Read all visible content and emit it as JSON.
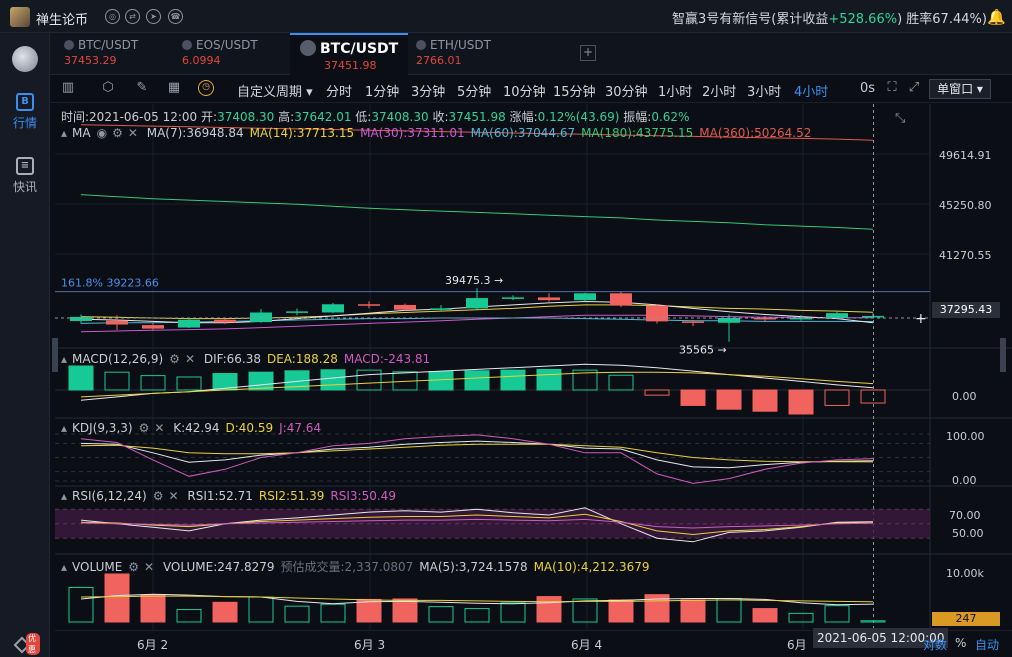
{
  "app": {
    "name": "禅生论币"
  },
  "signal": {
    "prefix": "智赢3号有新信号(累计收益",
    "gain": "+528.66%",
    "suffix": ")  胜率67.44%)"
  },
  "sidebar": {
    "items": [
      {
        "label": "行情",
        "icon": "B"
      },
      {
        "label": "快讯",
        "icon": "≡"
      }
    ],
    "promo": "优惠"
  },
  "tabs": [
    {
      "name": "BTC/USDT",
      "price": "37453.29"
    },
    {
      "name": "EOS/USDT",
      "price": "6.0994"
    },
    {
      "name": "BTC/USDT",
      "price": "37451.98"
    },
    {
      "name": "ETH/USDT",
      "price": "2766.01"
    }
  ],
  "toolbar": {
    "custom": "自定义周期",
    "intervals": [
      "分时",
      "1分钟",
      "3分钟",
      "5分钟",
      "10分钟",
      "15分钟",
      "30分钟",
      "1小时",
      "2小时",
      "3小时",
      "4小时"
    ],
    "active_interval": "4小时",
    "zero": "0s",
    "window": "单窗口"
  },
  "ohlc": {
    "time": "时间:2021-06-05 12:00",
    "open_label": "开:",
    "open": "37408.30",
    "high_label": "高:",
    "high": "37642.01",
    "low_label": "低:",
    "low": "37408.30",
    "close_label": "收:",
    "close": "37451.98",
    "chg_label": "涨幅:",
    "chg": "0.12%(43.69)",
    "amp_label": "振幅:",
    "amp": "0.62%"
  },
  "ma": {
    "name": "MA",
    "v7": "MA(7):36948.84",
    "v14": "MA(14):37713.15",
    "v30": "MA(30):37311.01",
    "v60": "MA(60):37044.67",
    "v180": "MA(180):43775.15",
    "v360": "MA(360):50264.52"
  },
  "price_axis": [
    "49614.91",
    "45250.80",
    "41270.55"
  ],
  "current_price": "37295.43",
  "fib": "161.8% 39223.66",
  "annotations": {
    "high": "39475.3 →",
    "low": "35565 →"
  },
  "macd": {
    "name": "MACD(12,26,9)",
    "dif": "DIF:66.38",
    "dea": "DEA:188.28",
    "macd": "MACD:-243.81",
    "axis": "0.00"
  },
  "kdj": {
    "name": "KDJ(9,3,3)",
    "k": "K:42.94",
    "d": "D:40.59",
    "j": "J:47.64",
    "axis_top": "100.00",
    "axis_bot": "0.00"
  },
  "rsi": {
    "name": "RSI(6,12,24)",
    "r1": "RSI1:52.71",
    "r2": "RSI2:51.39",
    "r3": "RSI3:50.49",
    "axis_top": "70.00",
    "axis_mid": "50.00"
  },
  "volume": {
    "name": "VOLUME",
    "v": "VOLUME:247.8279",
    "est": "预估成交量:2,337.0807",
    "ma5": "MA(5):3,724.1578",
    "ma10": "MA(10):4,212.3679",
    "axis": "10.00k",
    "current": "247"
  },
  "timeaxis": {
    "labels": [
      "6月 2",
      "6月 3",
      "6月 4",
      "6月"
    ],
    "cursor": "2021-06-05 12:00:00",
    "log": "对数",
    "pct": "%",
    "auto": "自动"
  },
  "colors": {
    "up": "#16c995",
    "down": "#f0635e",
    "accent": "#3b8ff0"
  },
  "chart_data": {
    "type": "candlestick",
    "candles": [
      {
        "o": 37080,
        "c": 37380,
        "h": 37560,
        "l": 36880
      },
      {
        "o": 37100,
        "c": 36820,
        "h": 37500,
        "l": 36420
      },
      {
        "o": 36780,
        "c": 36520,
        "h": 36960,
        "l": 36400
      },
      {
        "o": 36600,
        "c": 37170,
        "h": 37300,
        "l": 36560
      },
      {
        "o": 37170,
        "c": 36980,
        "h": 37250,
        "l": 36850
      },
      {
        "o": 37000,
        "c": 37700,
        "h": 37950,
        "l": 36950
      },
      {
        "o": 37700,
        "c": 37780,
        "h": 37990,
        "l": 37500
      },
      {
        "o": 37700,
        "c": 38300,
        "h": 38400,
        "l": 37650
      },
      {
        "o": 38300,
        "c": 38280,
        "h": 38520,
        "l": 38000
      },
      {
        "o": 38250,
        "c": 37900,
        "h": 38350,
        "l": 37800
      },
      {
        "o": 37900,
        "c": 38000,
        "h": 38250,
        "l": 37750
      },
      {
        "o": 38000,
        "c": 38750,
        "h": 39475.3,
        "l": 37900
      },
      {
        "o": 38750,
        "c": 38800,
        "h": 38950,
        "l": 38600
      },
      {
        "o": 38800,
        "c": 38600,
        "h": 39100,
        "l": 38480
      },
      {
        "o": 38600,
        "c": 39100,
        "h": 39150,
        "l": 38500
      },
      {
        "o": 39100,
        "c": 38200,
        "h": 39200,
        "l": 38100
      },
      {
        "o": 38200,
        "c": 37050,
        "h": 38300,
        "l": 36900
      },
      {
        "o": 37050,
        "c": 36950,
        "h": 37150,
        "l": 36700
      },
      {
        "o": 36950,
        "c": 37300,
        "h": 37550,
        "l": 35565
      },
      {
        "o": 37300,
        "c": 37250,
        "h": 37450,
        "l": 37000
      },
      {
        "o": 37250,
        "c": 37300,
        "h": 37520,
        "l": 37100
      },
      {
        "o": 37300,
        "c": 37650,
        "h": 37800,
        "l": 37250
      },
      {
        "o": 37400,
        "c": 37450,
        "h": 37650,
        "l": 37400
      }
    ],
    "ma7": [
      37200,
      37150,
      37050,
      36950,
      36950,
      37050,
      37250,
      37450,
      37650,
      37850,
      37950,
      38100,
      38250,
      38400,
      38500,
      38450,
      38250,
      38000,
      37750,
      37550,
      37400,
      37250,
      36949
    ],
    "ma14": [
      37400,
      37350,
      37300,
      37250,
      37250,
      37300,
      37350,
      37450,
      37600,
      37700,
      37800,
      37900,
      38000,
      38150,
      38250,
      38250,
      38200,
      38100,
      38000,
      37950,
      37850,
      37800,
      37713
    ],
    "ma30": [
      36300,
      36350,
      36400,
      36450,
      36500,
      36600,
      36700,
      36800,
      36900,
      37000,
      37100,
      37200,
      37300,
      37400,
      37500,
      37500,
      37500,
      37450,
      37400,
      37350,
      37350,
      37320,
      37311
    ],
    "ma60": [
      36900,
      36950,
      36950,
      37000,
      37050,
      37100,
      37150,
      37200,
      37250,
      37250,
      37300,
      37300,
      37300,
      37300,
      37250,
      37200,
      37150,
      37100,
      37100,
      37050,
      37050,
      37050,
      37045
    ],
    "ma180": [
      46300,
      46150,
      46000,
      45900,
      45800,
      45700,
      45600,
      45450,
      45300,
      45200,
      45100,
      45000,
      44900,
      44800,
      44700,
      44600,
      44450,
      44350,
      44250,
      44100,
      44000,
      43900,
      43775
    ],
    "ma360": [
      51400,
      51350,
      51300,
      51250,
      51200,
      51150,
      51100,
      51050,
      51000,
      50950,
      50900,
      50850,
      50800,
      50750,
      50700,
      50650,
      50600,
      50550,
      50500,
      50450,
      50400,
      50350,
      50265
    ],
    "macd_hist": [
      700,
      520,
      420,
      380,
      480,
      520,
      560,
      590,
      580,
      530,
      540,
      560,
      580,
      600,
      580,
      430,
      -150,
      -450,
      -560,
      -620,
      -700,
      -450,
      -380
    ],
    "macd_dif": [
      -300,
      -200,
      -100,
      -50,
      50,
      150,
      250,
      350,
      450,
      500,
      550,
      600,
      650,
      700,
      750,
      720,
      650,
      550,
      450,
      350,
      250,
      150,
      66
    ],
    "macd_dea": [
      -200,
      -150,
      -100,
      -50,
      0,
      50,
      100,
      150,
      200,
      250,
      300,
      350,
      400,
      450,
      500,
      520,
      520,
      500,
      450,
      400,
      330,
      250,
      188
    ],
    "kdj_k": [
      80,
      78,
      60,
      40,
      45,
      55,
      60,
      68,
      72,
      78,
      82,
      85,
      82,
      78,
      70,
      68,
      45,
      30,
      28,
      35,
      40,
      42,
      42.94
    ],
    "kdj_d": [
      75,
      76,
      70,
      60,
      58,
      58,
      60,
      64,
      68,
      72,
      76,
      78,
      78,
      78,
      75,
      72,
      60,
      50,
      45,
      42,
      41,
      41,
      40.59
    ],
    "kdj_j": [
      90,
      82,
      45,
      10,
      25,
      50,
      60,
      75,
      80,
      90,
      95,
      98,
      90,
      78,
      60,
      60,
      15,
      -5,
      5,
      25,
      38,
      45,
      47.64
    ],
    "rsi1": [
      55,
      50,
      45,
      40,
      50,
      55,
      58,
      62,
      66,
      68,
      66,
      70,
      65,
      62,
      72,
      50,
      30,
      25,
      38,
      40,
      45,
      52,
      52.71
    ],
    "rsi2": [
      52,
      51,
      48,
      46,
      50,
      53,
      55,
      57,
      59,
      60,
      60,
      62,
      60,
      58,
      63,
      53,
      40,
      35,
      40,
      42,
      46,
      51,
      51.39
    ],
    "rsi3": [
      51,
      50,
      49,
      48,
      50,
      51,
      52,
      53,
      54,
      55,
      55,
      56,
      55,
      54,
      56,
      52,
      46,
      44,
      46,
      47,
      48,
      50,
      50.49
    ],
    "vol": [
      7200,
      10000,
      5600,
      2600,
      4100,
      5200,
      3300,
      3700,
      4700,
      4800,
      3200,
      2800,
      4000,
      5300,
      4800,
      4600,
      5700,
      4600,
      4900,
      2800,
      1800,
      3400,
      248
    ],
    "vol_ma5": [
      4800,
      5500,
      5800,
      5600,
      5300,
      5200,
      4300,
      3800,
      4200,
      4300,
      4100,
      3900,
      3800,
      4000,
      4400,
      4500,
      4800,
      4900,
      4900,
      4700,
      4000,
      3600,
      3724
    ],
    "vol_ma10": [
      5200,
      5300,
      5400,
      5400,
      5300,
      5200,
      5000,
      4800,
      4600,
      4500,
      4500,
      4400,
      4300,
      4200,
      4300,
      4300,
      4400,
      4500,
      4600,
      4500,
      4400,
      4300,
      4212
    ],
    "xlabels": [
      "6月 2",
      "6月 3",
      "6月 4",
      "6月"
    ],
    "fib_level": 39223.66
  }
}
